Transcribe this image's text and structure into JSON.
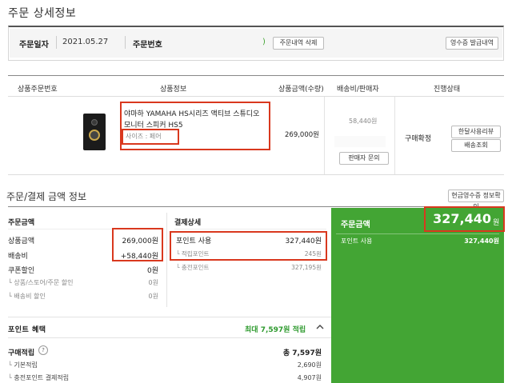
{
  "page": {
    "title": "주문 상세정보"
  },
  "order_info": {
    "date_label": "주문일자",
    "date_value": "2021.05.27",
    "number_label": "주문번호",
    "paren": ")",
    "delete_button": "주문내역 삭제",
    "receipt_button": "영수증 발급내역"
  },
  "table": {
    "headers": [
      "상품주문번호",
      "상품정보",
      "상품금액(수량)",
      "배송비/판매자",
      "진행상태"
    ]
  },
  "product": {
    "name_line1": "야마하 YAMAHA HS시리즈 액티브 스튜디오",
    "name_line2": "모니터 스피커 HS5",
    "option": "사이즈 : 페어",
    "price": "269,000원",
    "shipping": "58,440원",
    "seller_inquiry": "판매자 문의",
    "status": "구매확정",
    "review_button": "한달사용리뷰",
    "tracking_button": "배송조회"
  },
  "payment": {
    "section_title": "주문/결제 금액 정보",
    "cash_receipt_button": "현금영수증 정보확인",
    "order_amount_title": "주문금액",
    "rows": [
      {
        "label": "상품금액",
        "value": "269,000원"
      },
      {
        "label": "배송비",
        "value": "+58,440원"
      },
      {
        "label": "쿠폰할인",
        "value": "0원"
      }
    ],
    "sub_rows": [
      {
        "label": "상품/스토어/주문 할인",
        "value": "0원"
      },
      {
        "label": "배송비 할인",
        "value": "0원"
      }
    ],
    "detail_title": "결제상세",
    "point_use_label": "포인트 사용",
    "point_use_value": "327,440원",
    "accum_point_label": "적립포인트",
    "accum_point_value": "245원",
    "charge_point_label": "충전포인트",
    "charge_point_value": "327,195원",
    "green_title": "주문금액",
    "green_total": "327,440",
    "green_won": "원",
    "green_point_label": "포인트 사용",
    "green_point_value": "327,440원"
  },
  "benefit": {
    "title": "포인트 혜택",
    "max_text": "최대 7,597원 적립",
    "purchase_label": "구매적립",
    "help_icon": "?",
    "purchase_total": "총 7,597원",
    "basic_label": "기본적립",
    "basic_value": "2,690원",
    "charge_label": "충전포인트 결제적립",
    "charge_value": "4,907원"
  },
  "colors": {
    "accent_green": "#43a534",
    "highlight_red": "#d9381e",
    "benefit_green": "#2e9a2e"
  }
}
